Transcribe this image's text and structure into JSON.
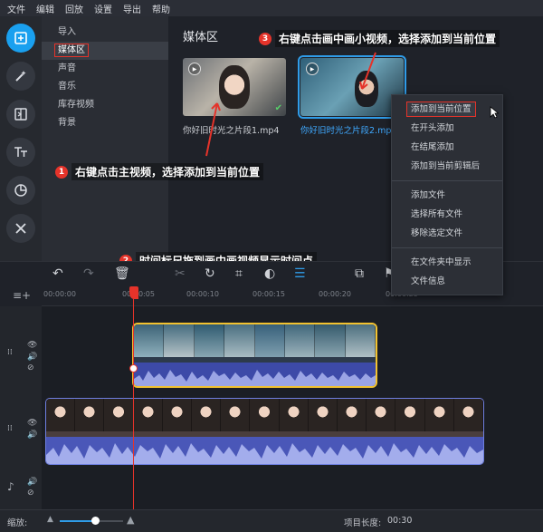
{
  "menu": [
    "文件",
    "编辑",
    "回放",
    "设置",
    "导出",
    "帮助"
  ],
  "tools": [
    {
      "name": "import-tool",
      "glyph": "⊞"
    },
    {
      "name": "magic-wand-tool",
      "glyph": "✦"
    },
    {
      "name": "transition-tool",
      "glyph": "◫"
    },
    {
      "name": "text-tool",
      "glyph": "Tт"
    },
    {
      "name": "sticker-tool",
      "glyph": "◔"
    },
    {
      "name": "more-tools",
      "glyph": "✕"
    }
  ],
  "categories": [
    "导入",
    "媒体区",
    "声音",
    "音乐",
    "库存视频",
    "背景"
  ],
  "media": {
    "title": "媒体区",
    "files": [
      "你好旧时光之片段1.mp4",
      "你好旧时光之片段2.mp4"
    ]
  },
  "context_menu": {
    "group1": [
      "添加到当前位置",
      "在开头添加",
      "在结尾添加",
      "添加到当前剪辑后"
    ],
    "group2": [
      "添加文件",
      "选择所有文件",
      "移除选定文件"
    ],
    "group3": [
      "在文件夹中显示",
      "文件信息"
    ]
  },
  "annotations": {
    "a1": {
      "num": "1",
      "text": "右键点击主视频，选择添加到当前位置"
    },
    "a2": {
      "num": "2",
      "text": "时间标尺拖到画中画视频显示时间点"
    },
    "a3": {
      "num": "3",
      "text": "右键点击画中画小视频，选择添加到当前位置"
    }
  },
  "ruler_ticks": [
    "00:00:00",
    "00:00:05",
    "00:00:10",
    "00:00:15",
    "00:00:20",
    "00:00:25"
  ],
  "status": {
    "zoom_label": "缩放:",
    "length_label": "项目长度:",
    "length_value": "00:30"
  },
  "colors": {
    "accent": "#1aa0ef",
    "annotation_red": "#e5332a",
    "pip_border": "#f2c230",
    "main_clip_border": "#6e7fe0"
  }
}
